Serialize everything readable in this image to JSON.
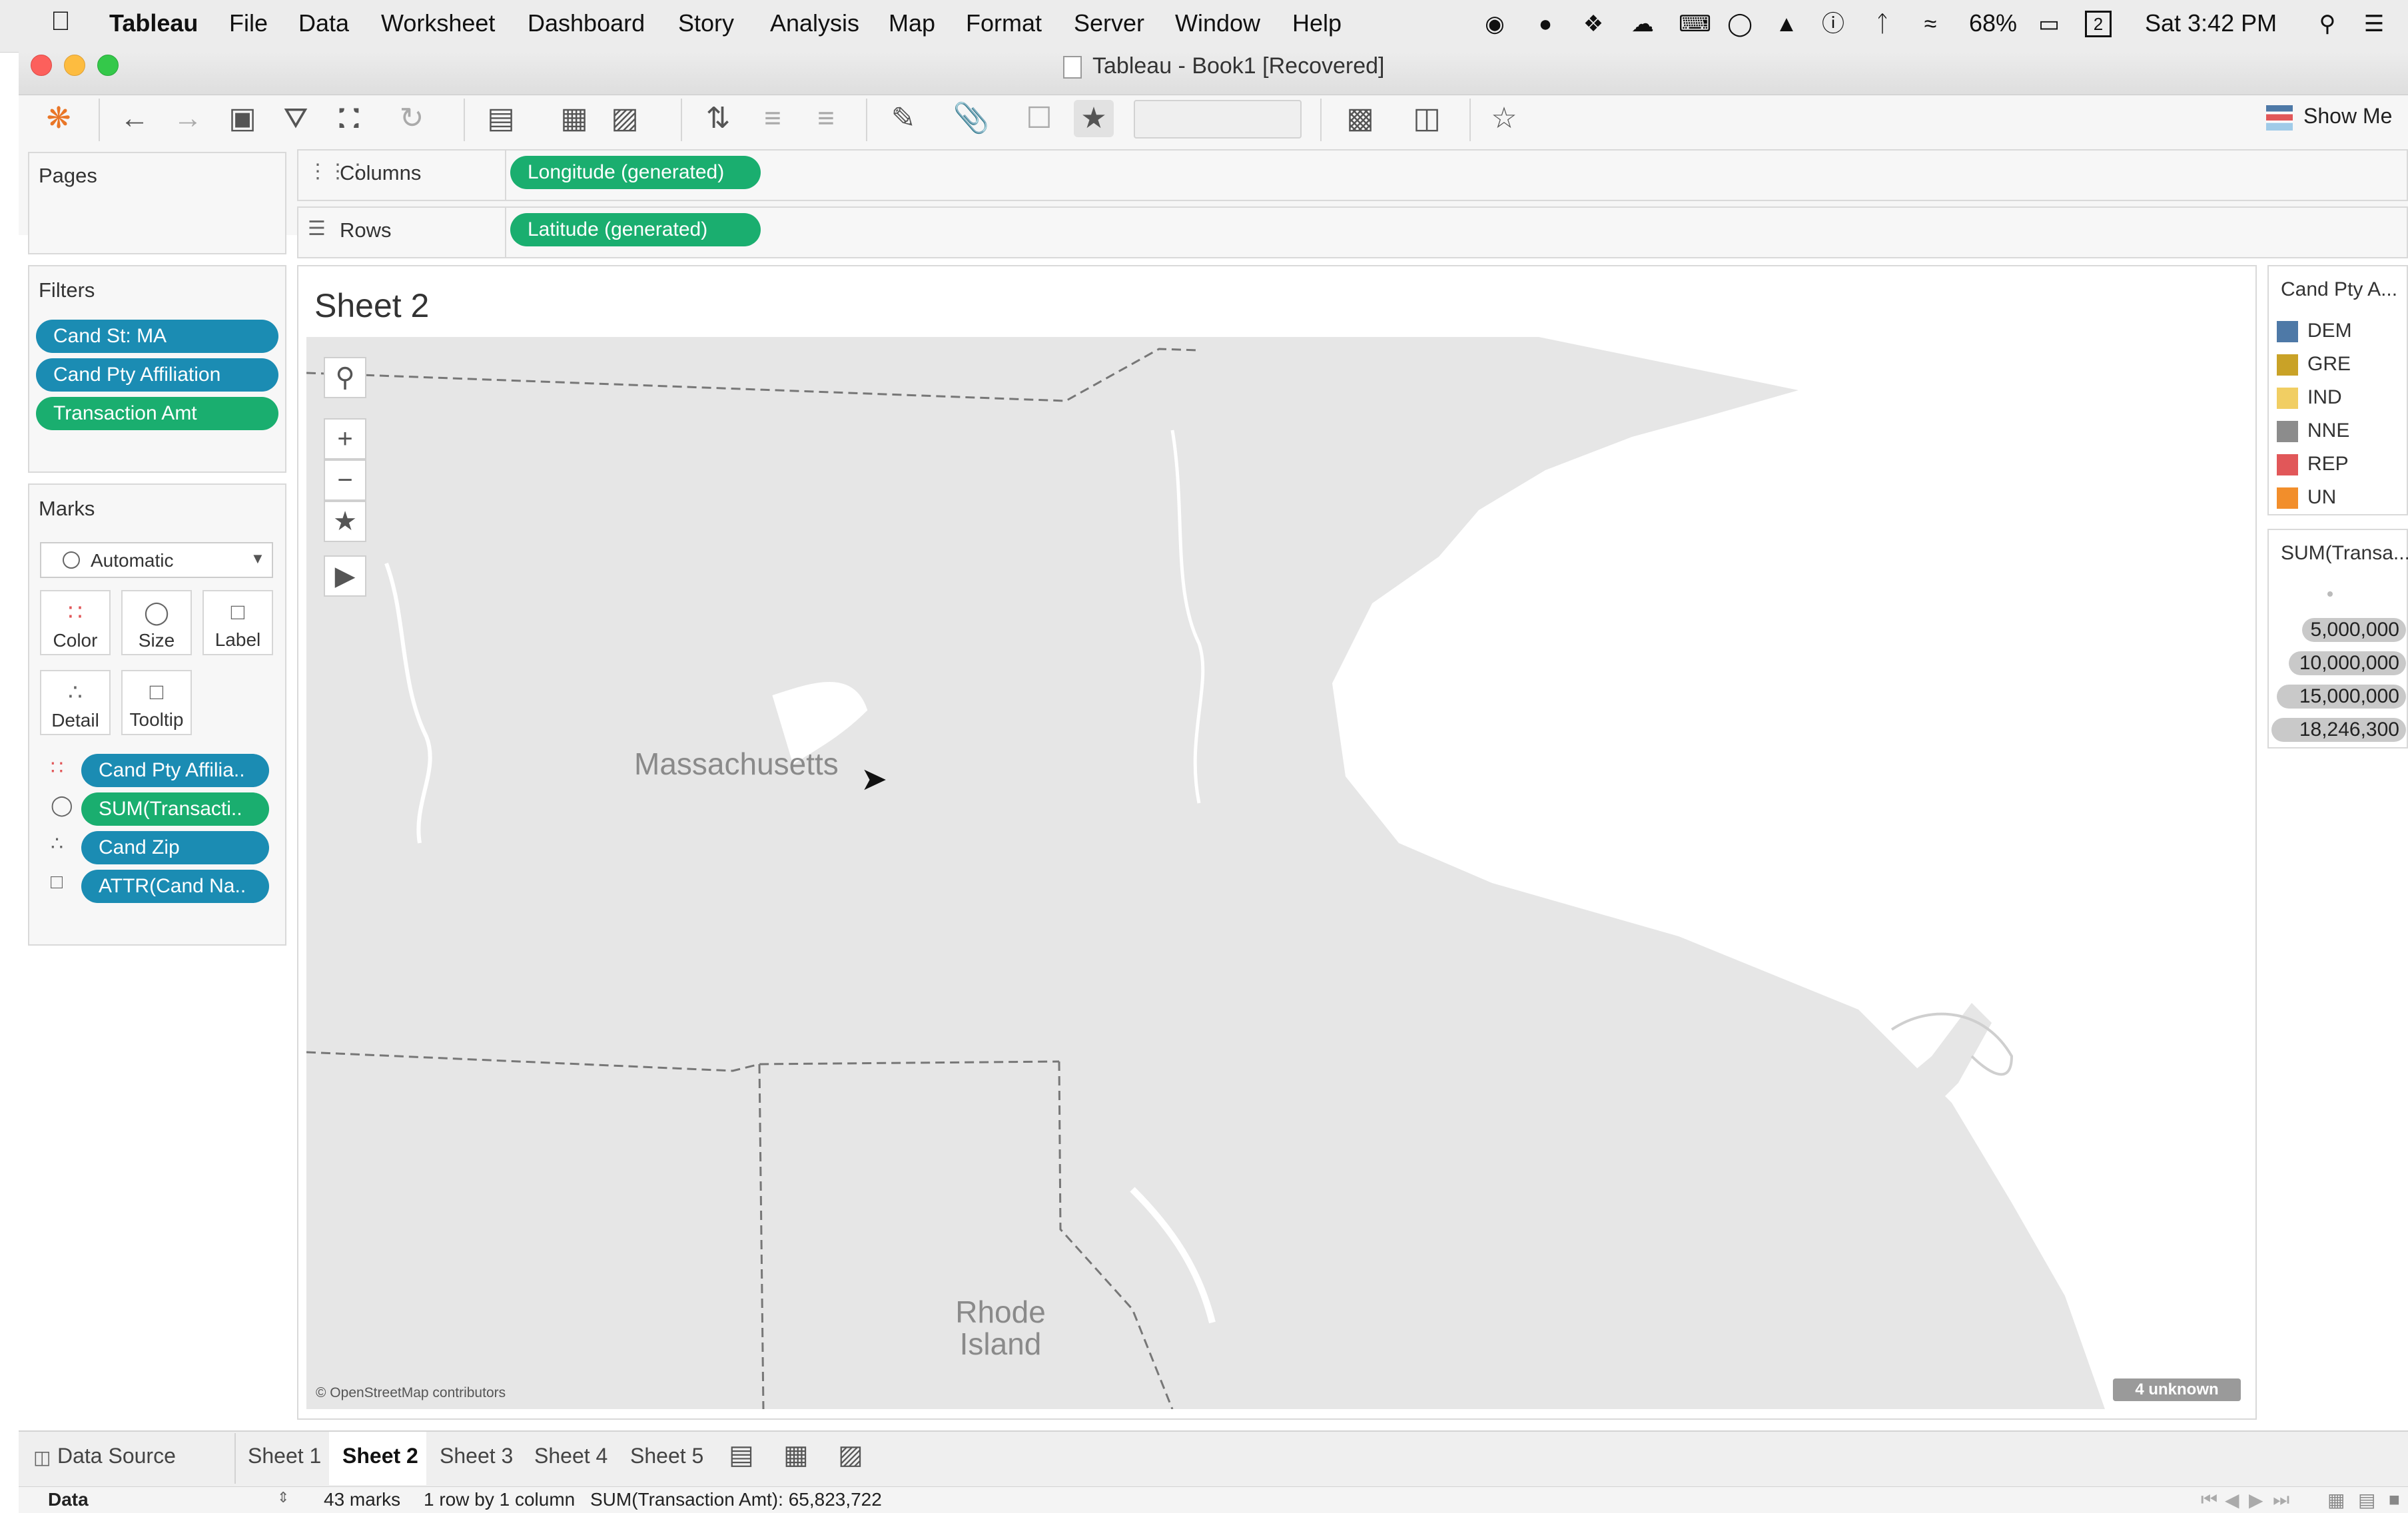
{
  "menubar": {
    "app_name": "Tableau",
    "items": [
      "File",
      "Data",
      "Worksheet",
      "Dashboard",
      "Story",
      "Analysis",
      "Map",
      "Format",
      "Server",
      "Window",
      "Help"
    ],
    "battery": "68%",
    "calendar_day": "2",
    "clock": "Sat 3:42 PM"
  },
  "window": {
    "title": "Tableau - Book1 [Recovered]"
  },
  "toolbar": {
    "show_me_label": "Show Me"
  },
  "pages": {
    "title": "Pages"
  },
  "filters": {
    "title": "Filters",
    "items": [
      "Cand St: MA",
      "Cand Pty Affiliation",
      "Transaction Amt"
    ]
  },
  "marks": {
    "title": "Marks",
    "type": "Automatic",
    "cards": {
      "color": "Color",
      "size": "Size",
      "label": "Label",
      "detail": "Detail",
      "tooltip": "Tooltip"
    },
    "fields": [
      "Cand Pty Affilia..",
      "SUM(Transacti..",
      "Cand Zip",
      "ATTR(Cand Na.."
    ]
  },
  "shelves": {
    "columns_label": "Columns",
    "columns_pill": "Longitude (generated)",
    "rows_label": "Rows",
    "rows_pill": "Latitude (generated)"
  },
  "sheet": {
    "title": "Sheet 2",
    "map_labels": {
      "state_ma": "Massachusetts",
      "state_ri": "Rhode Island"
    },
    "attribution": "© OpenStreetMap contributors",
    "unknown_badge": "4 unknown"
  },
  "legend_color": {
    "title": "Cand Pty A...",
    "items": [
      {
        "label": "DEM",
        "color": "#4e79a7"
      },
      {
        "label": "GRE",
        "color": "#c9a227"
      },
      {
        "label": "IND",
        "color": "#f1ce63"
      },
      {
        "label": "NNE",
        "color": "#8c8c8c"
      },
      {
        "label": "REP",
        "color": "#e15759"
      },
      {
        "label": "UN",
        "color": "#f28e2b"
      }
    ]
  },
  "legend_size": {
    "title": "SUM(Transa...",
    "items": [
      "5,000,000",
      "10,000,000",
      "15,000,000",
      "18,246,300"
    ]
  },
  "tabs": {
    "data_source": "Data Source",
    "sheets": [
      "Sheet 1",
      "Sheet 2",
      "Sheet 3",
      "Sheet 4",
      "Sheet 5"
    ],
    "active": "Sheet 2"
  },
  "statusbar": {
    "data_label": "Data",
    "marks": "43 marks",
    "dims": "1 row by 1 column",
    "sum": "SUM(Transaction Amt): 65,823,722"
  }
}
